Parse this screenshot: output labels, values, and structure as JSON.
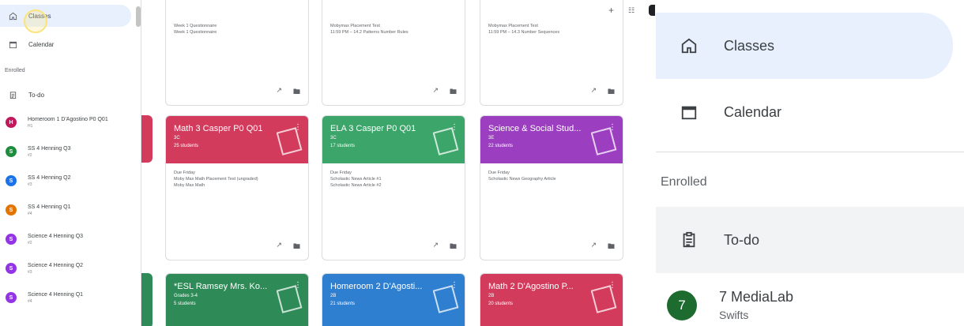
{
  "sidebar": {
    "nav": [
      {
        "label": "Classes",
        "icon": "home-icon"
      },
      {
        "label": "Calendar",
        "icon": "calendar-icon"
      }
    ],
    "section_label": "Enrolled",
    "todo_label": "To-do",
    "classes": [
      {
        "initial": "H",
        "name": "Homeroom 1 D'Agostino P0 Q01",
        "sub": "H1",
        "color": "#c2185b"
      },
      {
        "initial": "S",
        "name": "SS 4 Henning Q3",
        "sub": "#2",
        "color": "#1e8e3e"
      },
      {
        "initial": "S",
        "name": "SS 4 Henning Q2",
        "sub": "#3",
        "color": "#1a73e8"
      },
      {
        "initial": "S",
        "name": "SS 4 Henning Q1",
        "sub": "#4",
        "color": "#e37400"
      },
      {
        "initial": "S",
        "name": "Science 4 Henning Q3",
        "sub": "#2",
        "color": "#9334e6"
      },
      {
        "initial": "S",
        "name": "Science 4 Henning Q2",
        "sub": "#3",
        "color": "#9334e6"
      },
      {
        "initial": "S",
        "name": "Science 4 Henning Q1",
        "sub": "#4",
        "color": "#9334e6"
      }
    ]
  },
  "top_cards": [
    {
      "line1": "Week 1 Questionnaire",
      "line2": "Week 1 Questionnaire",
      "line3": ""
    },
    {
      "line1": "Mobymax Placement Test",
      "line2": "11:59 PM – 14.2 Patterns Number Rules",
      "line3": ""
    },
    {
      "line1": "Mobymax Placement Test",
      "line2": "11:59 PM – 14.3 Number Sequences",
      "line3": ""
    }
  ],
  "mid_cards": [
    {
      "title": "Math 3 Casper P0 Q01",
      "sub": "3C",
      "count": "25 students",
      "color": "#d33b5c",
      "due": "Due Friday",
      "item1": "Moby Max Math Placement Test (ungraded)",
      "item2": "Moby Max Math"
    },
    {
      "title": "ELA 3 Casper P0 Q01",
      "sub": "3C",
      "count": "17 students",
      "color": "#3ba56a",
      "due": "Due Friday",
      "item1": "Scholastic News Article #1",
      "item2": "Scholastic News Article #2"
    },
    {
      "title": "Science & Social Stud...",
      "sub": "3E",
      "count": "22 students",
      "color": "#9b3fc0",
      "due": "Due Friday",
      "item1": "Scholastic News Geography Article",
      "item2": ""
    }
  ],
  "bottom_cards": [
    {
      "title": "*ESL Ramsey Mrs. Ko...",
      "sub": "Grades 3-4",
      "count": "5 students",
      "color": "#2e8b57"
    },
    {
      "title": "Homeroom 2 D'Agosti...",
      "sub": "2B",
      "count": "21 students",
      "color": "#2f7fd1"
    },
    {
      "title": "Math 2 D'Agostino P...",
      "sub": "2B",
      "count": "20 students",
      "color": "#d33b5c"
    }
  ],
  "topbar": {
    "plus_icon": "plus-icon",
    "apps_icon": "apps-icon"
  },
  "zoom": {
    "classes_label": "Classes",
    "calendar_label": "Calendar",
    "section_label": "Enrolled",
    "todo_label": "To-do",
    "class_initial": "7",
    "class_name": "7 MediaLab",
    "class_sub": "Swifts"
  }
}
